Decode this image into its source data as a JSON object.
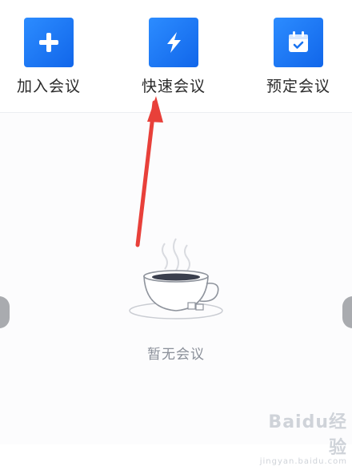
{
  "actions": [
    {
      "label": "加入会议",
      "icon": "plus-icon"
    },
    {
      "label": "快速会议",
      "icon": "lightning-icon"
    },
    {
      "label": "预定会议",
      "icon": "calendar-icon"
    }
  ],
  "empty_state": {
    "label": "暂无会议",
    "icon": "coffee-cup-icon"
  },
  "watermark": {
    "main": "Baidu经验",
    "sub": "jingyan.baidu.com"
  },
  "colors": {
    "tile": "#1f7cf6",
    "annotation_arrow": "#e8403a"
  }
}
